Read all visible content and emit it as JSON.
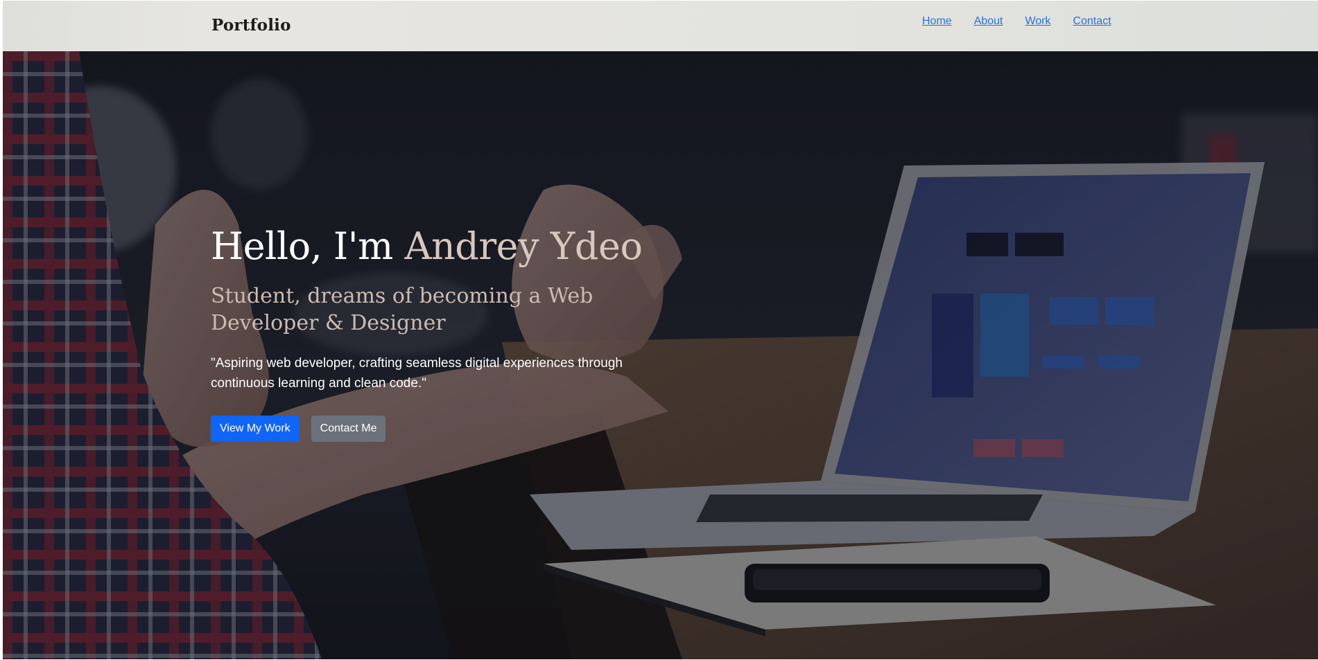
{
  "navbar": {
    "brand": "Portfolio",
    "links": [
      "Home",
      "About",
      "Work",
      "Contact"
    ]
  },
  "hero": {
    "greeting": "Hello, I'm",
    "name": "Andrey Ydeo",
    "subtitle": "Student, dreams of becoming a Web Developer & Designer",
    "quote": "\"Aspiring web developer, crafting seamless digital experiences through continuous learning and clean code.\"",
    "primary_button": "View My Work",
    "secondary_button": "Contact Me"
  },
  "colors": {
    "link": "#2f6fd6",
    "primary_button": "#1065f6",
    "secondary_button": "#6c727c",
    "name_accent": "#d8c8bd"
  }
}
